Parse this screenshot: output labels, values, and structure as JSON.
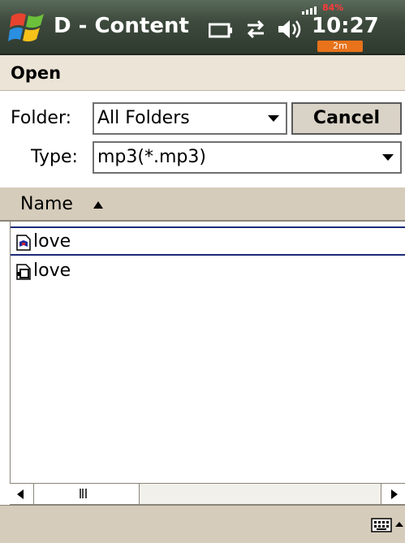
{
  "titlebar": {
    "app_title": "D - Content",
    "clock": "10:27",
    "battery_badge": "84%",
    "timer_badge": "2m"
  },
  "dialog": {
    "title": "Open",
    "folder": {
      "label": "Folder:",
      "value": "All Folders"
    },
    "type": {
      "label": "Type:",
      "value": "mp3(*.mp3)"
    },
    "cancel_label": "Cancel"
  },
  "list": {
    "column_name": "Name",
    "items": [
      {
        "name": "love",
        "icon": "audio-file-icon",
        "selected": true
      },
      {
        "name": "love",
        "icon": "folder-file-icon",
        "selected": false
      }
    ]
  },
  "icons": {
    "start": "windows-flag-icon",
    "connection": "connection-icon",
    "sync": "sync-icon",
    "volume": "speaker-icon",
    "keyboard": "keyboard-icon"
  }
}
